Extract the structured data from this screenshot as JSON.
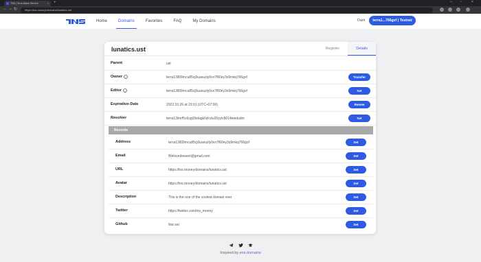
{
  "browser": {
    "tab_title": "TNS | Terra Name Service",
    "url": "https://tns.money/domains/lunatics.ust"
  },
  "header": {
    "nav": [
      "Home",
      "Domains",
      "Favorites",
      "FAQ",
      "My Domains"
    ],
    "network_label": "Dark",
    "wallet": "terra1...766gxf | Testnet"
  },
  "domain": {
    "name": "lunatics.ust",
    "tabs": [
      "Register",
      "Details"
    ],
    "details": {
      "parent_label": "Parent",
      "parent_value": "ust",
      "owner_label": "Owner",
      "owner_value": "terra13l83lrncu85cj0uaxuzly0vx7f60ey3s9rnkq766gxf",
      "owner_button": "Transfer",
      "editor_label": "Editor",
      "editor_value": "terra13l83lrncu85cj0uaxuzly0vx7f60ey3s9rnkq766gxf",
      "editor_button": "Set",
      "expiration_label": "Expiration Date",
      "expiration_value": "2022.10.26 at 23:01 (UTC+07:00)",
      "expiration_button": "Renew",
      "resolver_label": "Resolver",
      "resolver_value": "terra13lmrf5c6vgt2kdagk0zlcdu26yylc8014ewdudm",
      "resolver_button": "Set"
    },
    "records_title": "Records",
    "records": [
      {
        "label": "Address",
        "value": "terra13l83lrncu85cj0uaxuzly0vx7f60ey3s9rnkq766gxf",
        "button": "Set"
      },
      {
        "label": "Email",
        "value": "Welovedoweet@gmail.com",
        "button": "Set"
      },
      {
        "label": "URL",
        "value": "https://tns.money/domains/lunatics.ust",
        "button": "Set"
      },
      {
        "label": "Avatar",
        "value": "https://tns.money/domains/lunatics.ust",
        "button": "Set"
      },
      {
        "label": "Description",
        "value": "This is the one of the coolest domain ever",
        "button": "Set"
      },
      {
        "label": "Twitter",
        "value": "https://twitter.com/tns_money",
        "button": "Set"
      },
      {
        "label": "Github",
        "value": "Not set",
        "button": "Set"
      }
    ]
  },
  "footer": {
    "inspired_prefix": "Inspired by",
    "inspired_link": "ens.domains"
  },
  "colors": {
    "accent": "#2d5be3",
    "records_header": "#a9a9a9",
    "link": "#7a4fd6"
  }
}
